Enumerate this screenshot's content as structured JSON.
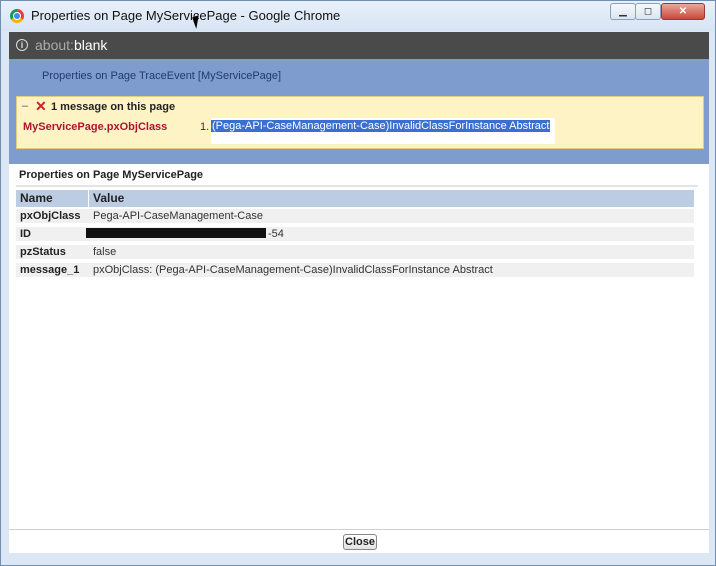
{
  "window": {
    "title": "Properties on Page MyServicePage - Google Chrome",
    "minimize_label": "▁",
    "maximize_label": "◻",
    "close_label": "✕"
  },
  "address": {
    "scheme": "about:",
    "host": "blank"
  },
  "header": {
    "title": "Properties on Page TraceEvent [MyServicePage]"
  },
  "messages": {
    "toggle": "–",
    "heading": "1 message on this page",
    "property": "MyServicePage.pxObjClass",
    "index": "1.",
    "text": "(Pega-API-CaseManagement-Case)InvalidClassForInstance Abstract"
  },
  "section": {
    "title": "Properties on Page MyServicePage"
  },
  "table": {
    "columns": [
      "Name",
      "Value"
    ],
    "rows": [
      {
        "name": "pxObjClass",
        "value": "Pega-API-CaseManagement-Case"
      },
      {
        "name": "ID",
        "value": "-54"
      },
      {
        "name": "pzStatus",
        "value": "false"
      },
      {
        "name": "message_1",
        "value": "pxObjClass: (Pega-API-CaseManagement-Case)InvalidClassForInstance Abstract"
      }
    ]
  },
  "footer": {
    "close_label": "Close"
  }
}
